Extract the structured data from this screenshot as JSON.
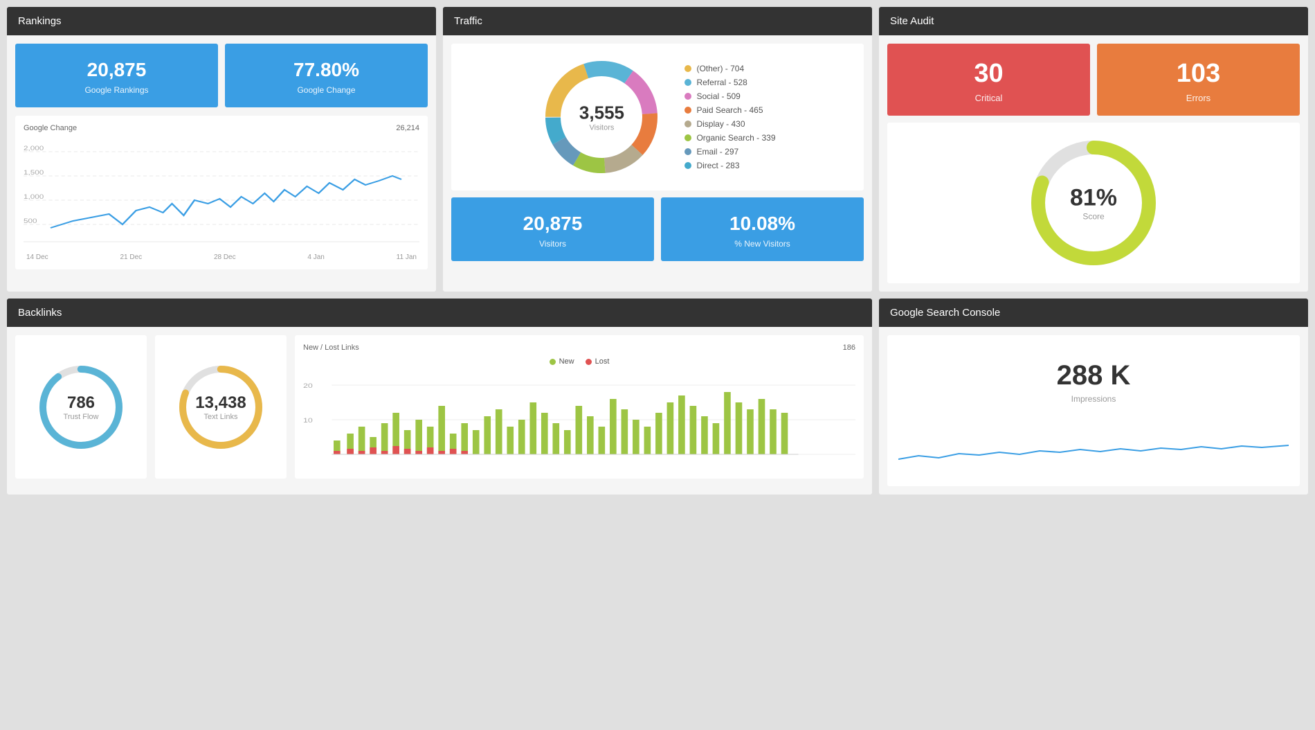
{
  "rankings": {
    "title": "Rankings",
    "google_rankings": "20,875",
    "google_rankings_label": "Google Rankings",
    "google_change": "77.80%",
    "google_change_label": "Google Change",
    "chart_title": "Google Change",
    "chart_total": "26,214",
    "y_labels": [
      "2,000",
      "1,500",
      "1,000",
      "500"
    ],
    "x_labels": [
      "14 Dec",
      "21 Dec",
      "28 Dec",
      "4 Jan",
      "11 Jan"
    ]
  },
  "traffic": {
    "title": "Traffic",
    "visitors_total": "3,555",
    "visitors_label": "Visitors",
    "legend": [
      {
        "label": "(Other) - 704",
        "color": "#e8b84b"
      },
      {
        "label": "Referral - 528",
        "color": "#5ab4d6"
      },
      {
        "label": "Social - 509",
        "color": "#d97bbf"
      },
      {
        "label": "Paid Search - 465",
        "color": "#e87c3e"
      },
      {
        "label": "Display - 430",
        "color": "#b5aa8e"
      },
      {
        "label": "Organic Search - 339",
        "color": "#9dc544"
      },
      {
        "label": "Email - 297",
        "color": "#6699bb"
      },
      {
        "label": "Direct - 283",
        "color": "#44aacc"
      }
    ],
    "visitors_count": "20,875",
    "visitors_count_label": "Visitors",
    "new_visitors_pct": "10.08%",
    "new_visitors_label": "% New Visitors"
  },
  "site_audit": {
    "title": "Site Audit",
    "critical_count": "30",
    "critical_label": "Critical",
    "errors_count": "103",
    "errors_label": "Errors",
    "score_pct": "81%",
    "score_label": "Score"
  },
  "backlinks": {
    "title": "Backlinks",
    "trust_flow_val": "786",
    "trust_flow_label": "Trust Flow",
    "text_links_val": "13,438",
    "text_links_label": "Text Links",
    "chart_title": "New / Lost Links",
    "chart_total": "186",
    "legend_new": "New",
    "legend_lost": "Lost",
    "new_color": "#9dc544",
    "lost_color": "#e05252",
    "y_labels": [
      "20",
      "10"
    ],
    "bars_new": [
      4,
      6,
      8,
      5,
      9,
      12,
      7,
      10,
      8,
      14,
      6,
      9,
      7,
      11,
      13,
      8,
      10,
      15,
      12,
      9,
      7,
      14,
      11,
      8,
      16,
      13,
      10,
      8,
      12,
      15,
      17,
      14,
      11,
      9,
      18,
      15,
      13,
      16,
      14,
      12
    ],
    "bars_lost": [
      1,
      2,
      1,
      2,
      1,
      3,
      2,
      1,
      2,
      1,
      2,
      1,
      3,
      2,
      1,
      2,
      3,
      1,
      2,
      1,
      2,
      1,
      2,
      3,
      1,
      2,
      1,
      2,
      3,
      2,
      1,
      2,
      1,
      3,
      2,
      1,
      2,
      1,
      2,
      3
    ]
  },
  "gsc": {
    "title": "Google Search Console",
    "impressions_val": "288 K",
    "impressions_label": "Impressions"
  }
}
